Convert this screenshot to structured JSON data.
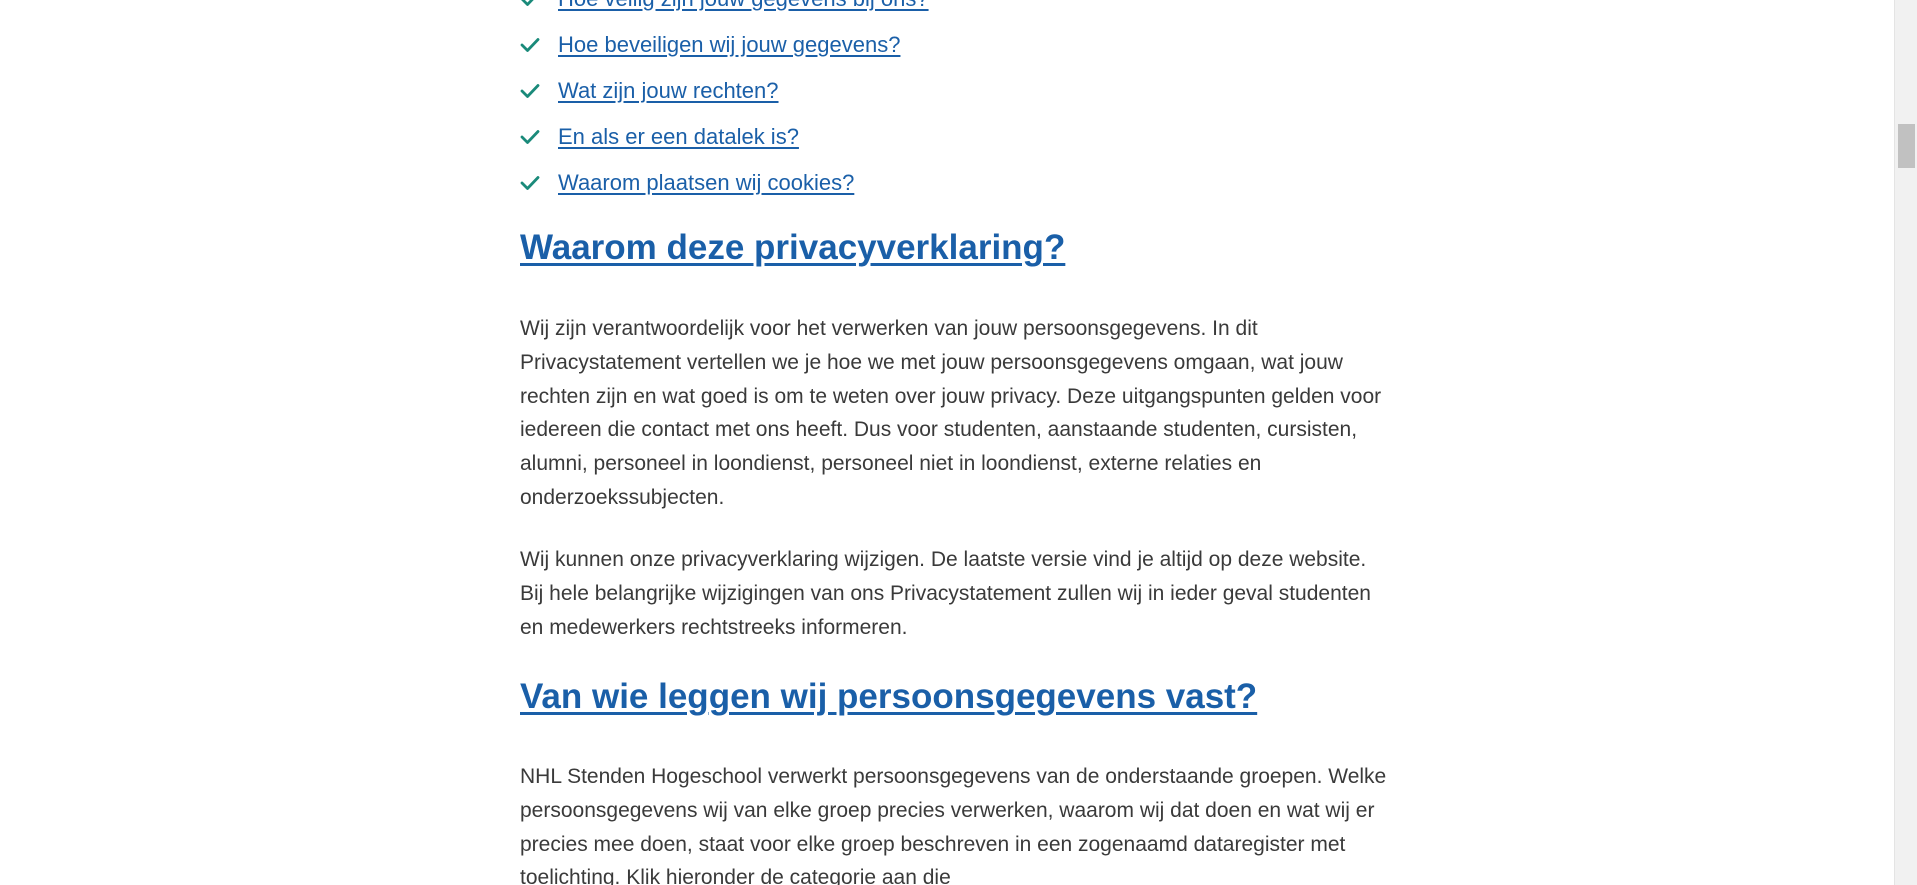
{
  "toc": {
    "items": [
      {
        "label": "Hoe veilig zijn jouw gegevens bij ons?"
      },
      {
        "label": "Hoe beveiligen wij jouw gegevens?"
      },
      {
        "label": "Wat zijn jouw rechten?"
      },
      {
        "label": "En als er een datalek is?"
      },
      {
        "label": "Waarom plaatsen wij cookies?"
      }
    ],
    "icon": "check-icon",
    "check_color": "#1a8a7a"
  },
  "section1": {
    "heading": "Waarom deze privacyverklaring?",
    "paragraph1": "Wij zijn verantwoordelijk voor het verwerken van jouw persoonsgegevens. In dit Privacystatement vertellen we je hoe we met jouw persoonsgegevens omgaan, wat jouw rechten zijn en wat goed is om te weten over jouw privacy. Deze uitgangspunten gelden voor iedereen die contact met ons heeft. Dus voor studenten, aanstaande studenten, cursisten, alumni, personeel in loondienst, personeel niet in loondienst, externe relaties en onderzoekssubjecten.",
    "paragraph2": "Wij kunnen onze privacyverklaring wijzigen. De laatste versie vind je altijd op deze website. Bij hele belangrijke wijzigingen van ons Privacystatement zullen wij in ieder geval studenten en medewerkers rechtstreeks informeren."
  },
  "section2": {
    "heading": "Van wie leggen wij persoonsgegevens vast?",
    "paragraph1": "NHL Stenden Hogeschool verwerkt persoonsgegevens van de onderstaande groepen. Welke persoonsgegevens wij van elke groep precies verwerken, waarom wij dat doen en wat wij er precies mee doen, staat voor elke groep beschreven in een zogenaamd dataregister met toelichting. Klik hieronder de categorie aan die"
  },
  "colors": {
    "link": "#1a5fa8",
    "text": "#3a3a3a",
    "check": "#1a8a7a"
  }
}
